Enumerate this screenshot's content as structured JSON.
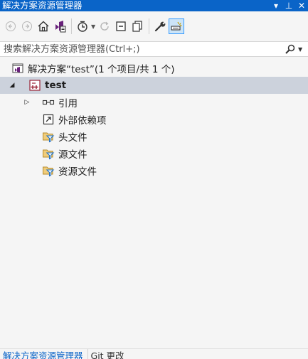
{
  "window": {
    "title": "解决方案资源管理器",
    "pin_symbol": "⊥",
    "close_symbol": "✕",
    "dropdown_symbol": "▾"
  },
  "search": {
    "placeholder": "搜索解决方案资源管理器(Ctrl+;)",
    "value": ""
  },
  "tree": {
    "solution": {
      "label": "解决方案“test”(1 个项目/共 1 个)"
    },
    "project": {
      "label": "test",
      "expanded": true
    },
    "children": [
      {
        "label": "引用",
        "icon": "references-icon",
        "expandable": true
      },
      {
        "label": "外部依赖项",
        "icon": "external-dependencies-icon",
        "expandable": false
      },
      {
        "label": "头文件",
        "icon": "filter-folder-icon",
        "expandable": false
      },
      {
        "label": "源文件",
        "icon": "filter-folder-icon",
        "expandable": false
      },
      {
        "label": "资源文件",
        "icon": "filter-folder-icon",
        "expandable": false
      }
    ]
  },
  "bottom_tabs": [
    {
      "label": "解决方案资源管理器",
      "active": true
    },
    {
      "label": "Git 更改",
      "active": false
    }
  ],
  "colors": {
    "accent": "#0a64c8",
    "selection": "#ccd2dc",
    "background": "#f5f5f5"
  }
}
